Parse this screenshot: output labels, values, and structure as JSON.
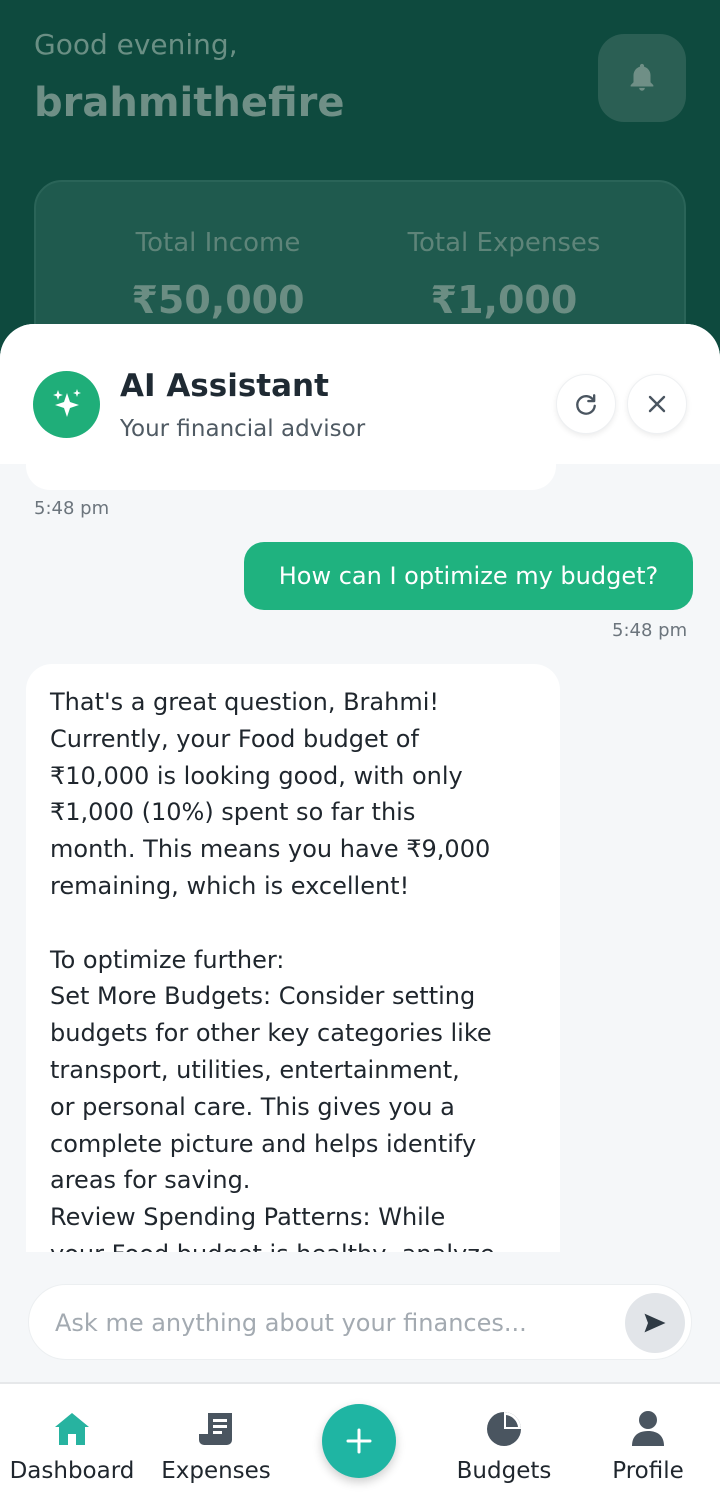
{
  "dashboard": {
    "greeting": "Good evening,",
    "username": "brahmithefire",
    "total_income_label": "Total Income",
    "total_income_value": "₹50,000",
    "total_expenses_label": "Total Expenses",
    "total_expenses_value": "₹1,000"
  },
  "chat": {
    "title": "AI Assistant",
    "subtitle": "Your financial advisor",
    "messages": [
      {
        "role": "assistant",
        "time": "5:48 pm"
      },
      {
        "role": "user",
        "text": "How can I optimize my budget?",
        "time": "5:48 pm"
      },
      {
        "role": "assistant",
        "text": "That's a great question, Brahmi!\nCurrently, your Food budget of\n₹10,000 is looking good, with only\n₹1,000 (10%) spent so far this\nmonth. This means you have ₹9,000\nremaining, which is excellent!\n\nTo optimize further:\nSet More Budgets: Consider setting\nbudgets for other key categories like\ntransport, utilities, entertainment,\nor personal care. This gives you a\ncomplete picture and helps identify\nareas for saving.\nReview Spending Patterns: While\nyour Food budget is healthy, analyze"
      }
    ],
    "input_placeholder": "Ask me anything about your finances..."
  },
  "nav": {
    "items": [
      {
        "label": "Dashboard",
        "icon": "home-icon"
      },
      {
        "label": "Expenses",
        "icon": "receipt-icon"
      },
      {
        "label": "Budgets",
        "icon": "pie-chart-icon"
      },
      {
        "label": "Profile",
        "icon": "user-icon"
      }
    ],
    "fab_icon": "plus-icon"
  },
  "colors": {
    "primary_green": "#1fb27f",
    "teal_accent": "#1fb5a3",
    "dashboard_bg": "#0e4a3e"
  }
}
